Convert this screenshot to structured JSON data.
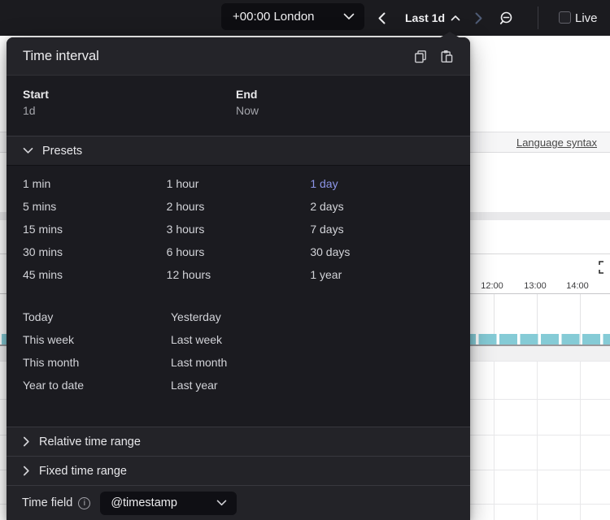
{
  "colors": {
    "accent": "#8c95e8",
    "bars": "#85cbd6",
    "topbar_bg": "#1b1b1f",
    "panel_bg": "#1b1b20",
    "panel_header_bg": "#242429"
  },
  "icons": {
    "chevron-down": "v",
    "chevron-up": "^",
    "chevron-left": "<",
    "chevron-right": ">",
    "zoom-out": "magnifier-minus",
    "copy": "overlapping-squares",
    "paste": "clipboard",
    "info": "i",
    "expand": "corner-brackets",
    "checkbox": "empty-square"
  },
  "topbar": {
    "timezone": "+00:00 London",
    "range_label": "Last 1d",
    "live_label": "Live"
  },
  "background": {
    "syntax_link": "Language syntax",
    "time_ticks": [
      "12:00",
      "13:00",
      "14:00"
    ]
  },
  "panel": {
    "title": "Time interval",
    "start_label": "Start",
    "start_value": "1d",
    "end_label": "End",
    "end_value": "Now",
    "presets_label": "Presets",
    "selected_preset": "1 day",
    "preset_columns": [
      [
        "1 min",
        "5 mins",
        "15 mins",
        "30 mins",
        "45 mins"
      ],
      [
        "1 hour",
        "2 hours",
        "3 hours",
        "6 hours",
        "12 hours"
      ],
      [
        "1 day",
        "2 days",
        "7 days",
        "30 days",
        "1 year"
      ]
    ],
    "named_presets": [
      [
        "Today",
        "Yesterday"
      ],
      [
        "This week",
        "Last week"
      ],
      [
        "This month",
        "Last month"
      ],
      [
        "Year to date",
        "Last year"
      ]
    ],
    "relative_label": "Relative time range",
    "fixed_label": "Fixed time range",
    "time_field_label": "Time field",
    "time_field_value": "@timestamp"
  }
}
